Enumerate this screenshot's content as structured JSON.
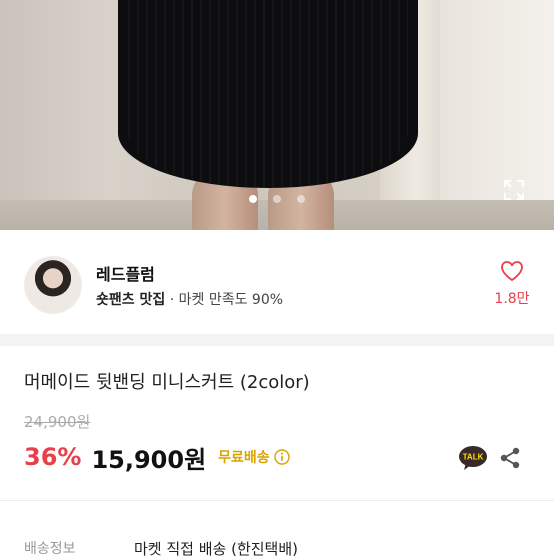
{
  "seller": {
    "name": "레드플럼",
    "tagline": "숏팬츠 맛집",
    "meta": "· 마켓 만족도 90%",
    "likes": "1.8만"
  },
  "product": {
    "title": "머메이드 뒷밴딩 미니스커트 (2color)",
    "original_price": "24,900원",
    "discount": "36%",
    "price": "15,900원",
    "free_shipping": "무료배송",
    "talk_label": "TALK"
  },
  "shipping": {
    "label": "배송정보",
    "value": "마켓 직접 배송 (한진택배)"
  },
  "gallery": {
    "total_slides": 3,
    "active_slide": 1
  },
  "colors": {
    "accent_red": "#e8404b",
    "shipping_yellow": "#d9a400",
    "kakao_yellow": "#fae100"
  }
}
